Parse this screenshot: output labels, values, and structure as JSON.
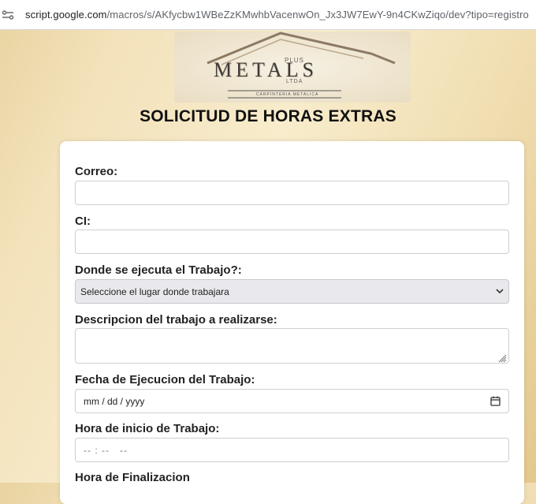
{
  "browser": {
    "url_host": "script.google.com",
    "url_path": "/macros/s/AKfycbw1WBeZzKMwhbVacenwOn_Jx3JW7EwY-9n4CKwZiqo/dev?tipo=registro",
    "site_info_icon": "site-settings-icon"
  },
  "logo": {
    "brand": "METALS",
    "superscript": "PLUS",
    "suffix": "LTDA",
    "tagline": "CARPINTERIA METALICA"
  },
  "form": {
    "title": "SOLICITUD DE HORAS EXTRAS",
    "email_label": "Correo:",
    "email_value": "",
    "ci_label": "CI:",
    "ci_value": "",
    "location_label": "Donde se ejecuta el Trabajo?:",
    "location_selected": "Seleccione el lugar donde trabajara",
    "description_label": "Descripcion del trabajo a realizarse:",
    "description_value": "",
    "date_label": "Fecha de Ejecucion del Trabajo:",
    "date_placeholder": "mm / dd / yyyy",
    "start_label": "Hora de inicio de Trabajo:",
    "start_placeholder": "-- : --   --",
    "end_label": "Hora de Finalizacion"
  }
}
